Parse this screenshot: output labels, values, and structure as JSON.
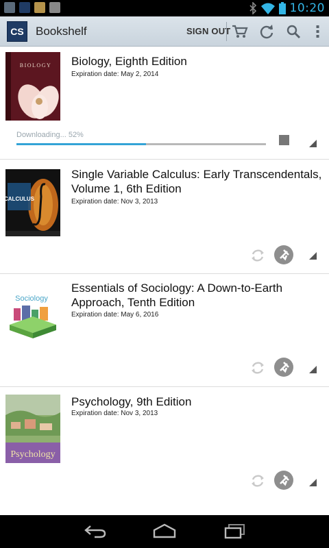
{
  "status_bar": {
    "time": "10:20",
    "notification_icons": [
      "picture-icon",
      "cs-app-icon",
      "shop-icon",
      "gmail-icon"
    ],
    "system_icons": [
      "bluetooth-icon",
      "wifi-icon",
      "battery-icon"
    ]
  },
  "action_bar": {
    "logo": "CS",
    "title": "Bookshelf",
    "sign_out": "SIGN OUT",
    "icons": [
      "cart-icon",
      "refresh-icon",
      "search-icon",
      "overflow-menu-icon"
    ]
  },
  "books": [
    {
      "title": "Biology, Eighth Edition",
      "expiration": "Expiration date: May 2, 2014",
      "cover_text": "BIOLOGY",
      "download": {
        "label": "Downloading... 52%",
        "progress": 0.52
      }
    },
    {
      "title": "Single Variable Calculus: Early Transcendentals, Volume 1, 6th Edition",
      "expiration": "Expiration date: Nov 3, 2013",
      "cover_text": "CALCULUS"
    },
    {
      "title": "Essentials of Sociology: A Down-to-Earth Approach, Tenth Edition",
      "expiration": "Expiration date: May 6, 2016",
      "cover_text": "Sociology"
    },
    {
      "title": "Psychology, 9th Edition",
      "expiration": "Expiration date: Nov 3, 2013",
      "cover_text": "Psychology"
    }
  ],
  "nav_bar": {
    "icons": [
      "back-icon",
      "home-icon",
      "recent-apps-icon"
    ]
  },
  "colors": {
    "accent": "#33b5e5",
    "progress": "#33a3d6",
    "app_logo": "#1f3b64"
  }
}
